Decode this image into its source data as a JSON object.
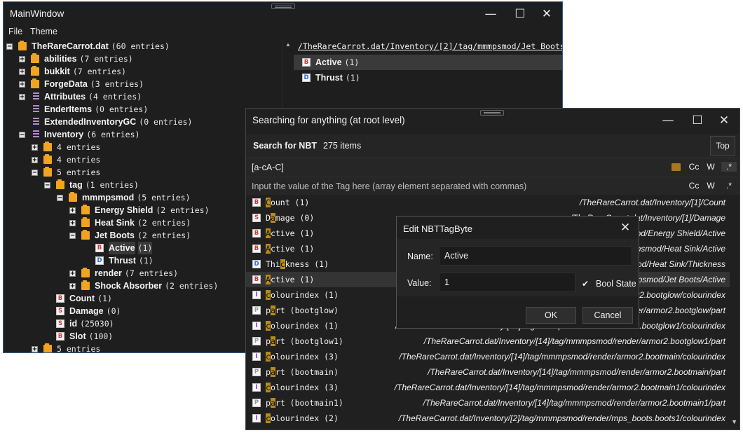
{
  "main": {
    "title": "MainWindow",
    "menu": [
      "File",
      "Theme"
    ],
    "tree": [
      {
        "name": "TheRareCarrot.dat",
        "count": "(60 entries)",
        "icon": "folder",
        "exp": "−"
      },
      {
        "name": "abilities",
        "count": "(7 entries)",
        "icon": "folder",
        "exp": "+"
      },
      {
        "name": "bukkit",
        "count": "(7 entries)",
        "icon": "folder",
        "exp": "+"
      },
      {
        "name": "ForgeData",
        "count": "(3 entries)",
        "icon": "folder",
        "exp": "+"
      },
      {
        "name": "Attributes",
        "count": "(4 entries)",
        "icon": "list",
        "exp": "+"
      },
      {
        "name": "EnderItems",
        "count": "(0 entries)",
        "icon": "list",
        "exp": ""
      },
      {
        "name": "ExtendedInventoryGC",
        "count": "(0 entries)",
        "icon": "list",
        "exp": ""
      },
      {
        "name": "Inventory",
        "count": "(6 entries)",
        "icon": "list",
        "exp": "−"
      },
      {
        "name": "",
        "count": "4 entries",
        "icon": "folder",
        "exp": "+"
      },
      {
        "name": "",
        "count": "4 entries",
        "icon": "folder",
        "exp": "+"
      },
      {
        "name": "",
        "count": "5 entries",
        "icon": "folder",
        "exp": "−"
      },
      {
        "name": "tag",
        "count": "(1 entries)",
        "icon": "folder",
        "exp": "−"
      },
      {
        "name": "mmmpsmod",
        "count": "(5 entries)",
        "icon": "folder",
        "exp": "−"
      },
      {
        "name": "Energy Shield",
        "count": "(2 entries)",
        "icon": "folder",
        "exp": "+"
      },
      {
        "name": "Heat Sink",
        "count": "(2 entries)",
        "icon": "folder",
        "exp": "+"
      },
      {
        "name": "Jet Boots",
        "count": "(2 entries)",
        "icon": "folder",
        "exp": "−"
      },
      {
        "name": "Active",
        "count": "(1)",
        "icon": "B",
        "exp": ""
      },
      {
        "name": "Thrust",
        "count": "(1)",
        "icon": "D",
        "exp": ""
      },
      {
        "name": "render",
        "count": "(7 entries)",
        "icon": "folder",
        "exp": "+"
      },
      {
        "name": "Shock Absorber",
        "count": "(2 entries)",
        "icon": "folder",
        "exp": "+"
      },
      {
        "name": "Count",
        "count": "(1)",
        "icon": "B",
        "exp": ""
      },
      {
        "name": "Damage",
        "count": "(0)",
        "icon": "S",
        "exp": ""
      },
      {
        "name": "id",
        "count": "(25030)",
        "icon": "S",
        "exp": ""
      },
      {
        "name": "Slot",
        "count": "(100)",
        "icon": "B",
        "exp": ""
      },
      {
        "name": "",
        "count": "5 entries",
        "icon": "folder",
        "exp": "+"
      }
    ],
    "path": "/TheRareCarrot.dat/Inventory/[2]/tag/mmmpsmod/Jet Boots",
    "right_items": [
      {
        "name": "Active",
        "count": "(1)",
        "icon": "B"
      },
      {
        "name": "Thrust",
        "count": "(1)",
        "icon": "D"
      }
    ]
  },
  "search": {
    "title": "Searching for anything (at root level)",
    "label": "Search for NBT",
    "count": "275 items",
    "top_label": "Top",
    "regex": "[a-cA-C]",
    "value_placeholder": "Input the value of the Tag here (array element separated with commas)",
    "opts": [
      "Cc",
      "W",
      ".*"
    ],
    "results": [
      {
        "pre": "",
        "hl": "C",
        "post": "ount (1)",
        "path": "/TheRareCarrot.dat/Inventory/[1]/Count",
        "icon": "B"
      },
      {
        "pre": "D",
        "hl": "a",
        "post": "mage (0)",
        "path": "/TheRareCarrot.dat/Inventory/[1]/Damage",
        "icon": "S"
      },
      {
        "pre": "",
        "hl": "A",
        "post": "ctive (1)",
        "path": "/TheRareCarrot.dat/Inventory/[2]/tag/mmmpsmod/Energy Shield/Active",
        "icon": "B"
      },
      {
        "pre": "",
        "hl": "A",
        "post": "ctive (1)",
        "path": "/TheRareCarrot.dat/Inventory/[2]/tag/mmmpsmod/Heat Sink/Active",
        "icon": "B"
      },
      {
        "pre": "Thi",
        "hl": "c",
        "post": "kness (1)",
        "path": "/TheRareCarrot.dat/Inventory/[2]/tag/mmmpsmod/Heat Sink/Thickness",
        "icon": "D"
      },
      {
        "pre": "",
        "hl": "A",
        "post": "ctive (1)",
        "path": "/TheRareCarrot.dat/Inventory/[2]/tag/mmmpsmod/Jet Boots/Active",
        "icon": "B"
      },
      {
        "pre": "",
        "hl": "c",
        "post": "olourindex (1)",
        "path": "/TheRareCarrot.dat/Inventory/[14]/tag/mmmpsmod/render/armor2.bootglow/colourindex",
        "icon": "I"
      },
      {
        "pre": "p",
        "hl": "a",
        "post": "rt (bootglow)",
        "path": "/TheRareCarrot.dat/Inventory/[14]/tag/mmmpsmod/render/armor2.bootglow/part",
        "icon": "P"
      },
      {
        "pre": "",
        "hl": "c",
        "post": "olourindex (1)",
        "path": "/TheRareCarrot.dat/Inventory/[14]/tag/mmmpsmod/render/armor2.bootglow1/colourindex",
        "icon": "I"
      },
      {
        "pre": "p",
        "hl": "a",
        "post": "rt (bootglow1)",
        "path": "/TheRareCarrot.dat/Inventory/[14]/tag/mmmpsmod/render/armor2.bootglow1/part",
        "icon": "P"
      },
      {
        "pre": "",
        "hl": "c",
        "post": "olourindex (3)",
        "path": "/TheRareCarrot.dat/Inventory/[14]/tag/mmmpsmod/render/armor2.bootmain/colourindex",
        "icon": "I"
      },
      {
        "pre": "p",
        "hl": "a",
        "post": "rt (bootmain)",
        "path": "/TheRareCarrot.dat/Inventory/[14]/tag/mmmpsmod/render/armor2.bootmain/part",
        "icon": "P"
      },
      {
        "pre": "",
        "hl": "c",
        "post": "olourindex (3)",
        "path": "/TheRareCarrot.dat/Inventory/[14]/tag/mmmpsmod/render/armor2.bootmain1/colourindex",
        "icon": "I"
      },
      {
        "pre": "p",
        "hl": "a",
        "post": "rt (bootmain1)",
        "path": "/TheRareCarrot.dat/Inventory/[14]/tag/mmmpsmod/render/armor2.bootmain1/part",
        "icon": "P"
      },
      {
        "pre": "",
        "hl": "c",
        "post": "olourindex (2)",
        "path": "/TheRareCarrot.dat/Inventory/[2]/tag/mmmpsmod/render/mps_boots.boots1/colourindex",
        "icon": "I"
      }
    ]
  },
  "dialog": {
    "title": "Edit NBTTagByte",
    "name_label": "Name:",
    "name_value": "Active",
    "value_label": "Value:",
    "value_value": "1",
    "bool_label": "Bool State",
    "ok": "OK",
    "cancel": "Cancel"
  },
  "colors": {
    "folder": "#f0a422",
    "highlight": "#b88a18",
    "border": "#2f5f8f"
  }
}
